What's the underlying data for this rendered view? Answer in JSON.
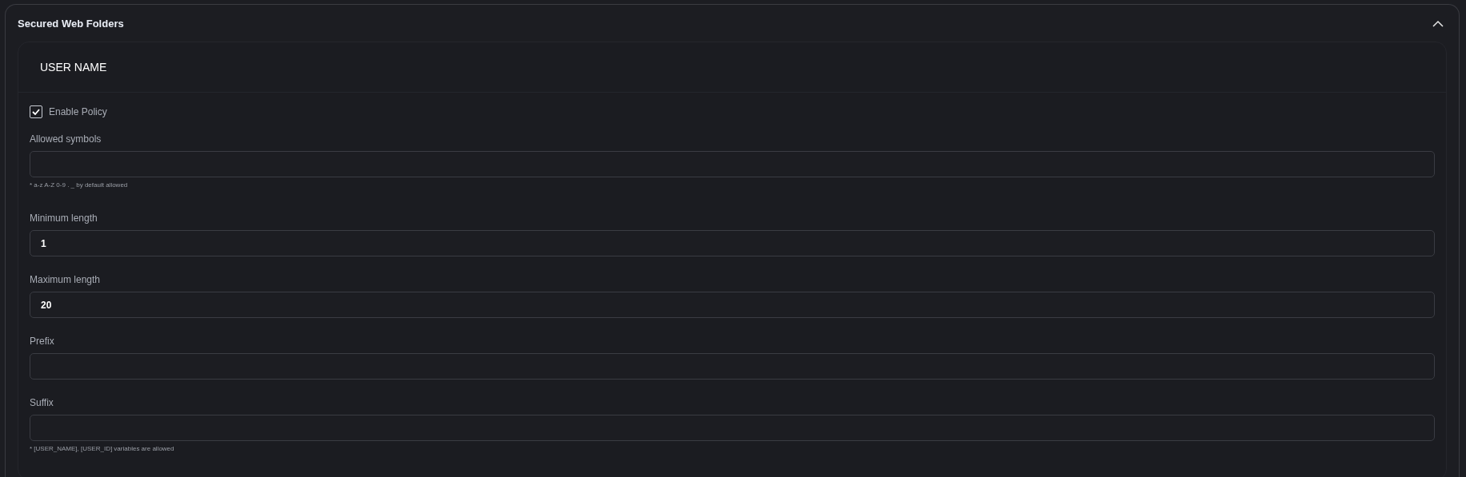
{
  "panel": {
    "title": "Secured Web Folders",
    "expanded": true
  },
  "section": {
    "title": "USER NAME"
  },
  "enable_policy": {
    "label": "Enable Policy",
    "checked": true
  },
  "fields": [
    {
      "label": "Allowed symbols",
      "hint": "* a-z A-Z 0-9 . _ by default allowed"
    },
    {
      "label": "Minimum length",
      "value": "1"
    },
    {
      "label": "Maximum length",
      "value": "20"
    },
    {
      "label": "Prefix"
    },
    {
      "label": "Suffix",
      "hint": "* [USER_NAME], [USER_ID] variables are allowed"
    }
  ]
}
